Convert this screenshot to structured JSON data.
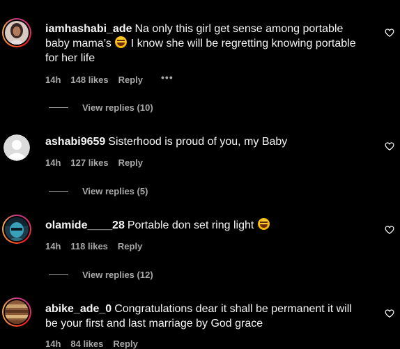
{
  "comments": [
    {
      "username": "iamhashabi_ade",
      "text_before_emoji": "Na only this girl get sense among portable baby mama’s",
      "text_after_emoji": "I know she will be regretting knowing portable for her life",
      "emoji_icon": "laughing-face-emoji",
      "time": "14h",
      "likes": "148 likes",
      "reply_label": "Reply",
      "more_label": "•••",
      "view_replies": "View replies (10)"
    },
    {
      "username": "ashabi9659",
      "text": "Sisterhood is proud of you, my Baby",
      "time": "14h",
      "likes": "127 likes",
      "reply_label": "Reply",
      "view_replies": "View replies (5)"
    },
    {
      "username": "olamide____28",
      "text": "Portable don set ring light",
      "emoji_icon": "laughing-face-emoji",
      "time": "14h",
      "likes": "118 likes",
      "reply_label": "Reply",
      "view_replies": "View replies (12)"
    },
    {
      "username": "abike_ade_0",
      "text": "Congratulations dear it shall be permanent it will be your first and last marriage by God grace",
      "time": "14h",
      "likes": "84 likes",
      "reply_label": "Reply"
    }
  ],
  "icons": {
    "like": "heart-outline-icon",
    "avatar_default": "default-avatar-icon"
  },
  "colors": {
    "background": "#000000",
    "primary_text": "#f5f5f5",
    "secondary_text": "#a8a8a8"
  }
}
